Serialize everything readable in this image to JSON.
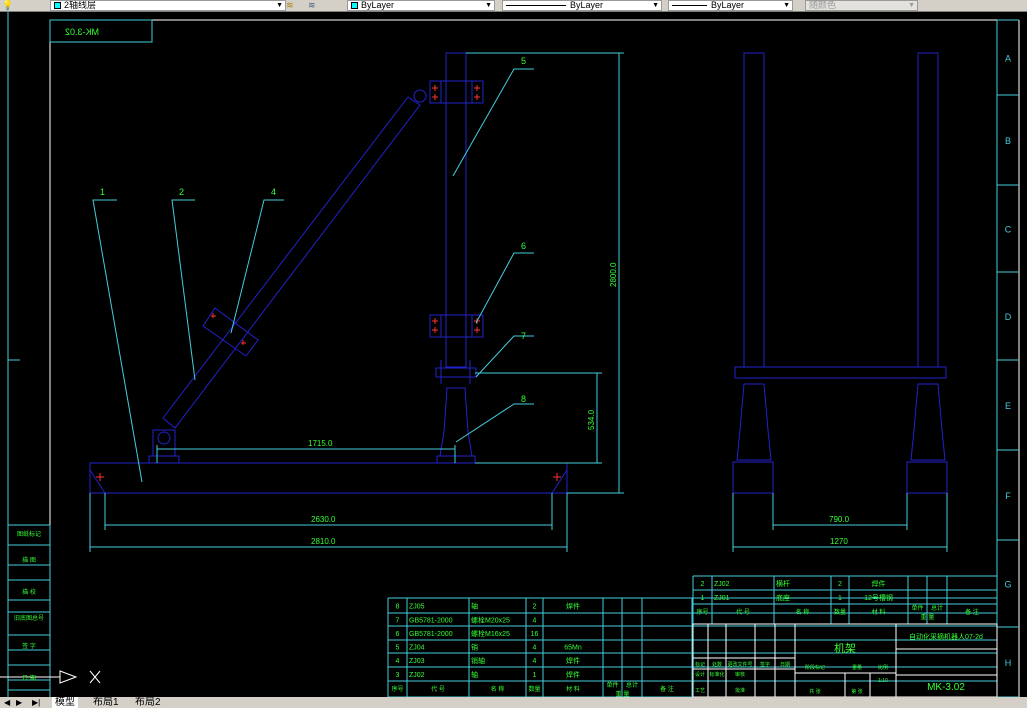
{
  "toolbar": {
    "layer_name": "2轴线层",
    "color": "ByLayer",
    "linetype": "ByLayer",
    "lineweight": "ByLayer",
    "plot_style": "随颜色"
  },
  "tabs": [
    "模型",
    "布局1",
    "布局2"
  ],
  "drawing": {
    "mirrored_code": "MK-3.02",
    "row_labels": [
      "A",
      "B",
      "C",
      "D",
      "E",
      "F",
      "G",
      "H"
    ],
    "balloons": [
      "1",
      "2",
      "4",
      "5",
      "6",
      "7",
      "8"
    ],
    "dimensions": {
      "d1715": "1715.0",
      "d534": "534.0",
      "d2800": "2800.0",
      "d2630": "2630.0",
      "d2810": "2810.0",
      "d790": "790.0",
      "d1270": "1270"
    },
    "left_strip": [
      "图纸标记",
      "描 图",
      "描 校",
      "旧底图总号",
      "签 字",
      "日 期"
    ]
  },
  "parts_table": {
    "rows": [
      [
        "8",
        "ZJ05",
        "轴",
        "2",
        "焊件"
      ],
      [
        "7",
        "GB5781-2000",
        "螺栓M20x25",
        "4",
        ""
      ],
      [
        "6",
        "GB5781-2000",
        "螺栓M16x25",
        "16",
        ""
      ],
      [
        "5",
        "ZJ04",
        "销",
        "4",
        "65Mn"
      ],
      [
        "4",
        "ZJ03",
        "销轴",
        "4",
        "焊件"
      ],
      [
        "3",
        "ZJ02",
        "轴",
        "1",
        "焊件"
      ]
    ],
    "header": [
      "序号",
      "代 号",
      "名 称",
      "数量",
      "材 料",
      "单件",
      "总计",
      "重 量",
      "备 注"
    ]
  },
  "upper_table": {
    "rows": [
      [
        "2",
        "ZJ02",
        "横杆",
        "2",
        "焊件"
      ],
      [
        "1",
        "ZJ01",
        "底座",
        "1",
        "12号槽钢"
      ]
    ],
    "header": [
      "序号",
      "代 号",
      "名 称",
      "数量",
      "材 料",
      "单件",
      "总计",
      "重 量",
      "备 注"
    ]
  },
  "title_block": {
    "part_name": "机架",
    "project": "自动化采摘机器人07-2d",
    "drawing_no": "MK-3.02",
    "labels": [
      "标记",
      "处数",
      "更改文件号",
      "签字",
      "日期",
      "设计",
      "标准化",
      "审核",
      "阶段标记",
      "重量",
      "比例",
      "工艺",
      "批准",
      "共 张",
      "第 张",
      "1:10"
    ]
  }
}
